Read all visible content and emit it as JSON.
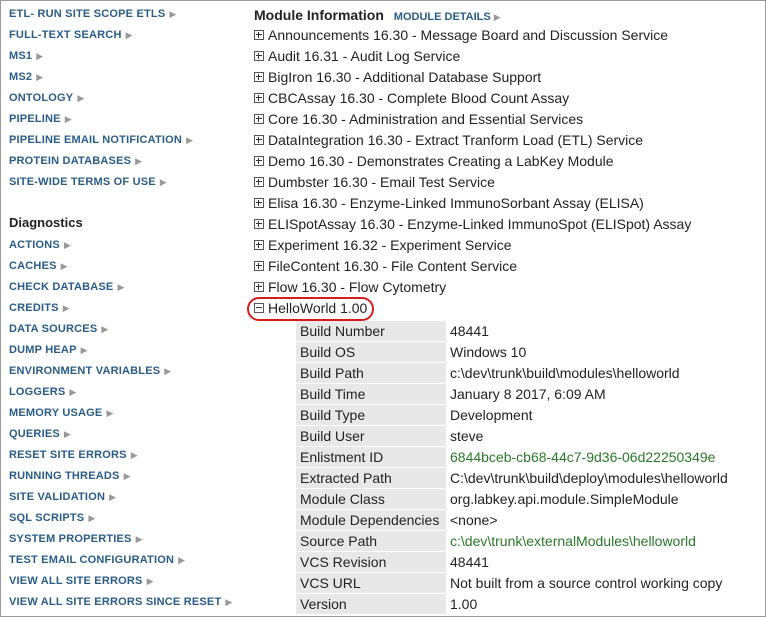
{
  "sidebar_top": [
    {
      "label": "ETL- RUN SITE SCOPE ETLS"
    },
    {
      "label": "FULL-TEXT SEARCH"
    },
    {
      "label": "MS1"
    },
    {
      "label": "MS2"
    },
    {
      "label": "ONTOLOGY"
    },
    {
      "label": "PIPELINE"
    },
    {
      "label": "PIPELINE EMAIL NOTIFICATION"
    },
    {
      "label": "PROTEIN DATABASES"
    },
    {
      "label": "SITE-WIDE TERMS OF USE"
    }
  ],
  "diagnostics": {
    "heading": "Diagnostics",
    "items": [
      {
        "label": "ACTIONS"
      },
      {
        "label": "CACHES"
      },
      {
        "label": "CHECK DATABASE"
      },
      {
        "label": "CREDITS"
      },
      {
        "label": "DATA SOURCES"
      },
      {
        "label": "DUMP HEAP"
      },
      {
        "label": "ENVIRONMENT VARIABLES"
      },
      {
        "label": "LOGGERS"
      },
      {
        "label": "MEMORY USAGE"
      },
      {
        "label": "QUERIES"
      },
      {
        "label": "RESET SITE ERRORS"
      },
      {
        "label": "RUNNING THREADS"
      },
      {
        "label": "SITE VALIDATION"
      },
      {
        "label": "SQL SCRIPTS"
      },
      {
        "label": "SYSTEM PROPERTIES"
      },
      {
        "label": "TEST EMAIL CONFIGURATION"
      },
      {
        "label": "VIEW ALL SITE ERRORS"
      },
      {
        "label": "VIEW ALL SITE ERRORS SINCE RESET"
      }
    ]
  },
  "main": {
    "title": "Module Information",
    "details_link": "MODULE DETAILS",
    "modules": [
      {
        "label": "Announcements 16.30 - Message Board and Discussion Service"
      },
      {
        "label": "Audit 16.31 - Audit Log Service"
      },
      {
        "label": "BigIron 16.30 - Additional Database Support"
      },
      {
        "label": "CBCAssay 16.30 - Complete Blood Count Assay"
      },
      {
        "label": "Core 16.30 - Administration and Essential Services"
      },
      {
        "label": "DataIntegration 16.30 - Extract Tranform Load (ETL) Service"
      },
      {
        "label": "Demo 16.30 - Demonstrates Creating a LabKey Module"
      },
      {
        "label": "Dumbster 16.30 - Email Test Service"
      },
      {
        "label": "Elisa 16.30 - Enzyme-Linked ImmunoSorbant Assay (ELISA)"
      },
      {
        "label": "ELISpotAssay 16.30 - Enzyme-Linked ImmunoSpot (ELISpot) Assay"
      },
      {
        "label": "Experiment 16.32 - Experiment Service"
      },
      {
        "label": "FileContent 16.30 - File Content Service"
      },
      {
        "label": "Flow 16.30 - Flow Cytometry"
      }
    ],
    "expanded_module": {
      "label": "HelloWorld 1.00",
      "properties": [
        {
          "key": "Build Number",
          "value": "48441"
        },
        {
          "key": "Build OS",
          "value": "Windows 10"
        },
        {
          "key": "Build Path",
          "value": "c:\\dev\\trunk\\build\\modules\\helloworld"
        },
        {
          "key": "Build Time",
          "value": "January 8 2017, 6:09 AM"
        },
        {
          "key": "Build Type",
          "value": "Development"
        },
        {
          "key": "Build User",
          "value": "steve"
        },
        {
          "key": "Enlistment ID",
          "value": "6844bceb-cb68-44c7-9d36-06d22250349e"
        },
        {
          "key": "Extracted Path",
          "value": "C:\\dev\\trunk\\build\\deploy\\modules\\helloworld"
        },
        {
          "key": "Module Class",
          "value": "org.labkey.api.module.SimpleModule"
        },
        {
          "key": "Module Dependencies",
          "value": "<none>"
        },
        {
          "key": "Source Path",
          "value": "c:\\dev\\trunk\\externalModules\\helloworld"
        },
        {
          "key": "VCS Revision",
          "value": "48441"
        },
        {
          "key": "VCS URL",
          "value": "Not built from a source control working copy"
        },
        {
          "key": "Version",
          "value": "1.00"
        }
      ]
    }
  },
  "colors": {
    "link": "#2a5c8a",
    "green_value": "#2a7a2a",
    "highlight_oval": "#d41c1c",
    "key_bg": "#e8e8e8"
  }
}
